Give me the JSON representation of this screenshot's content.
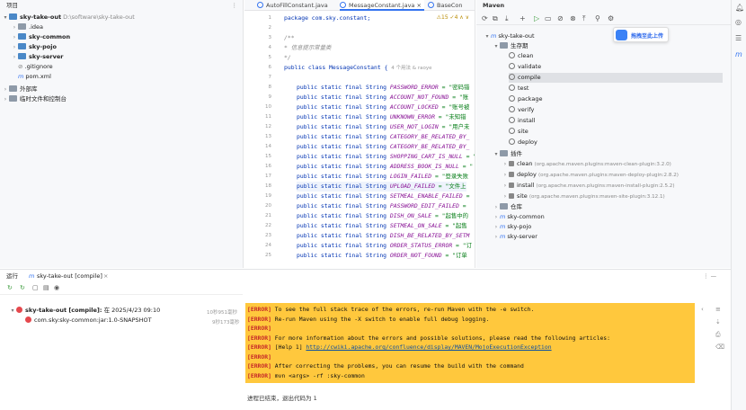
{
  "project": {
    "title": "项目",
    "more": "⋮",
    "root_name": "sky-take-out",
    "root_path": "D:\\software\\sky-take-out",
    "children": [
      {
        "label": ".idea"
      },
      {
        "label": "sky-common"
      },
      {
        "label": "sky-pojo"
      },
      {
        "label": "sky-server"
      },
      {
        "label": ".gitignore"
      },
      {
        "label": "pom.xml"
      }
    ],
    "external": "外部库",
    "scratch": "临时文件和控制台"
  },
  "editor": {
    "tabs": [
      {
        "label": "AutoFillConstant.java"
      },
      {
        "label": "MessageConstant.java"
      },
      {
        "label": "BaseCon"
      }
    ],
    "warnings": "⚠15 ✓4 ∧ ∨",
    "lines": [
      "1",
      "2",
      "3",
      "4",
      "5",
      "6",
      "7",
      "8",
      "9",
      "10",
      "11",
      "12",
      "13",
      "14",
      "15",
      "16",
      "17",
      "18",
      "19",
      "20",
      "21",
      "22",
      "23",
      "24",
      "25"
    ],
    "package_line": "package com.sky.constant;",
    "comment": [
      "/**",
      " * 信息提示常量类",
      " */"
    ],
    "class_decl": "public class MessageConstant {",
    "class_hint": "4 个用法   & raoye",
    "field_prefix": "public static final String",
    "fields": [
      {
        "name": "PASSWORD_ERROR",
        "val": "= \"密码错"
      },
      {
        "name": "ACCOUNT_NOT_FOUND",
        "val": "= \"账"
      },
      {
        "name": "ACCOUNT_LOCKED",
        "val": "= \"账号被"
      },
      {
        "name": "UNKNOWN_ERROR",
        "val": "= \"未知错"
      },
      {
        "name": "USER_NOT_LOGIN",
        "val": "= \"用户未"
      },
      {
        "name": "CATEGORY_BE_RELATED_BY_",
        "val": ""
      },
      {
        "name": "CATEGORY_BE_RELATED_BY_",
        "val": ""
      },
      {
        "name": "SHOPPING_CART_IS_NULL",
        "val": "= \""
      },
      {
        "name": "ADDRESS_BOOK_IS_NULL",
        "val": "= \""
      },
      {
        "name": "LOGIN_FAILED",
        "val": "= \"登录失败"
      },
      {
        "name": "UPLOAD_FAILED",
        "val": "= \"文件上"
      },
      {
        "name": "SETMEAL_ENABLE_FAILED",
        "val": "="
      },
      {
        "name": "PASSWORD_EDIT_FAILED",
        "val": "="
      },
      {
        "name": "DISH_ON_SALE",
        "val": "= \"起售中的"
      },
      {
        "name": "SETMEAL_ON_SALE",
        "val": "= \"起售"
      },
      {
        "name": "DISH_BE_RELATED_BY_SETM",
        "val": ""
      },
      {
        "name": "ORDER_STATUS_ERROR",
        "val": "= \"订"
      },
      {
        "name": "ORDER_NOT_FOUND",
        "val": "= \"订单"
      }
    ]
  },
  "maven": {
    "title": "Maven",
    "root": "sky-take-out",
    "lifecycle": "生存期",
    "phases": [
      "clean",
      "validate",
      "compile",
      "test",
      "package",
      "verify",
      "install",
      "site",
      "deploy"
    ],
    "plugins_label": "插件",
    "plugins": [
      {
        "name": "clean",
        "coord": "(org.apache.maven.plugins:maven-clean-plugin:3.2.0)"
      },
      {
        "name": "deploy",
        "coord": "(org.apache.maven.plugins:maven-deploy-plugin:2.8.2)"
      },
      {
        "name": "install",
        "coord": "(org.apache.maven.plugins:maven-install-plugin:2.5.2)"
      },
      {
        "name": "site",
        "coord": "(org.apache.maven.plugins:maven-site-plugin:3.12.1)"
      }
    ],
    "repo": "仓库",
    "modules": [
      "sky-common",
      "sky-pojo",
      "sky-server"
    ],
    "upload_tip": "拖拽至此上传"
  },
  "run": {
    "label": "运行",
    "tab": "sky-take-out [compile]",
    "close": "×",
    "more": "⋮ —",
    "tree_root": "sky-take-out [compile]:",
    "tree_root_time": "在 2025/4/23 09:10",
    "tree_root_dur": "10秒951毫秒",
    "tree_child": "com.sky:sky-common:jar:1.0-SNAPSHOT",
    "tree_child_dur": "9秒173毫秒",
    "console": [
      {
        "tag": "[ERROR]",
        "text": " To see the full stack trace of the errors, re-run Maven with the -e switch."
      },
      {
        "tag": "[ERROR]",
        "text": " Re-run Maven using the -X switch to enable full debug logging."
      },
      {
        "tag": "[ERROR]",
        "text": ""
      },
      {
        "tag": "[ERROR]",
        "text": " For more information about the errors and possible solutions, please read the following articles:"
      },
      {
        "tag": "[ERROR]",
        "text": " [Help 1] ",
        "link": "http://cwiki.apache.org/confluence/display/MAVEN/MojoExecutionException"
      },
      {
        "tag": "[ERROR]",
        "text": ""
      },
      {
        "tag": "[ERROR]",
        "text": " After correcting the problems, you can resume the build with the command"
      },
      {
        "tag": "[ERROR]",
        "text": "   mvn <args> -rf :sky-common"
      }
    ],
    "exit_msg": "进程已结束，退出代码为 1"
  }
}
